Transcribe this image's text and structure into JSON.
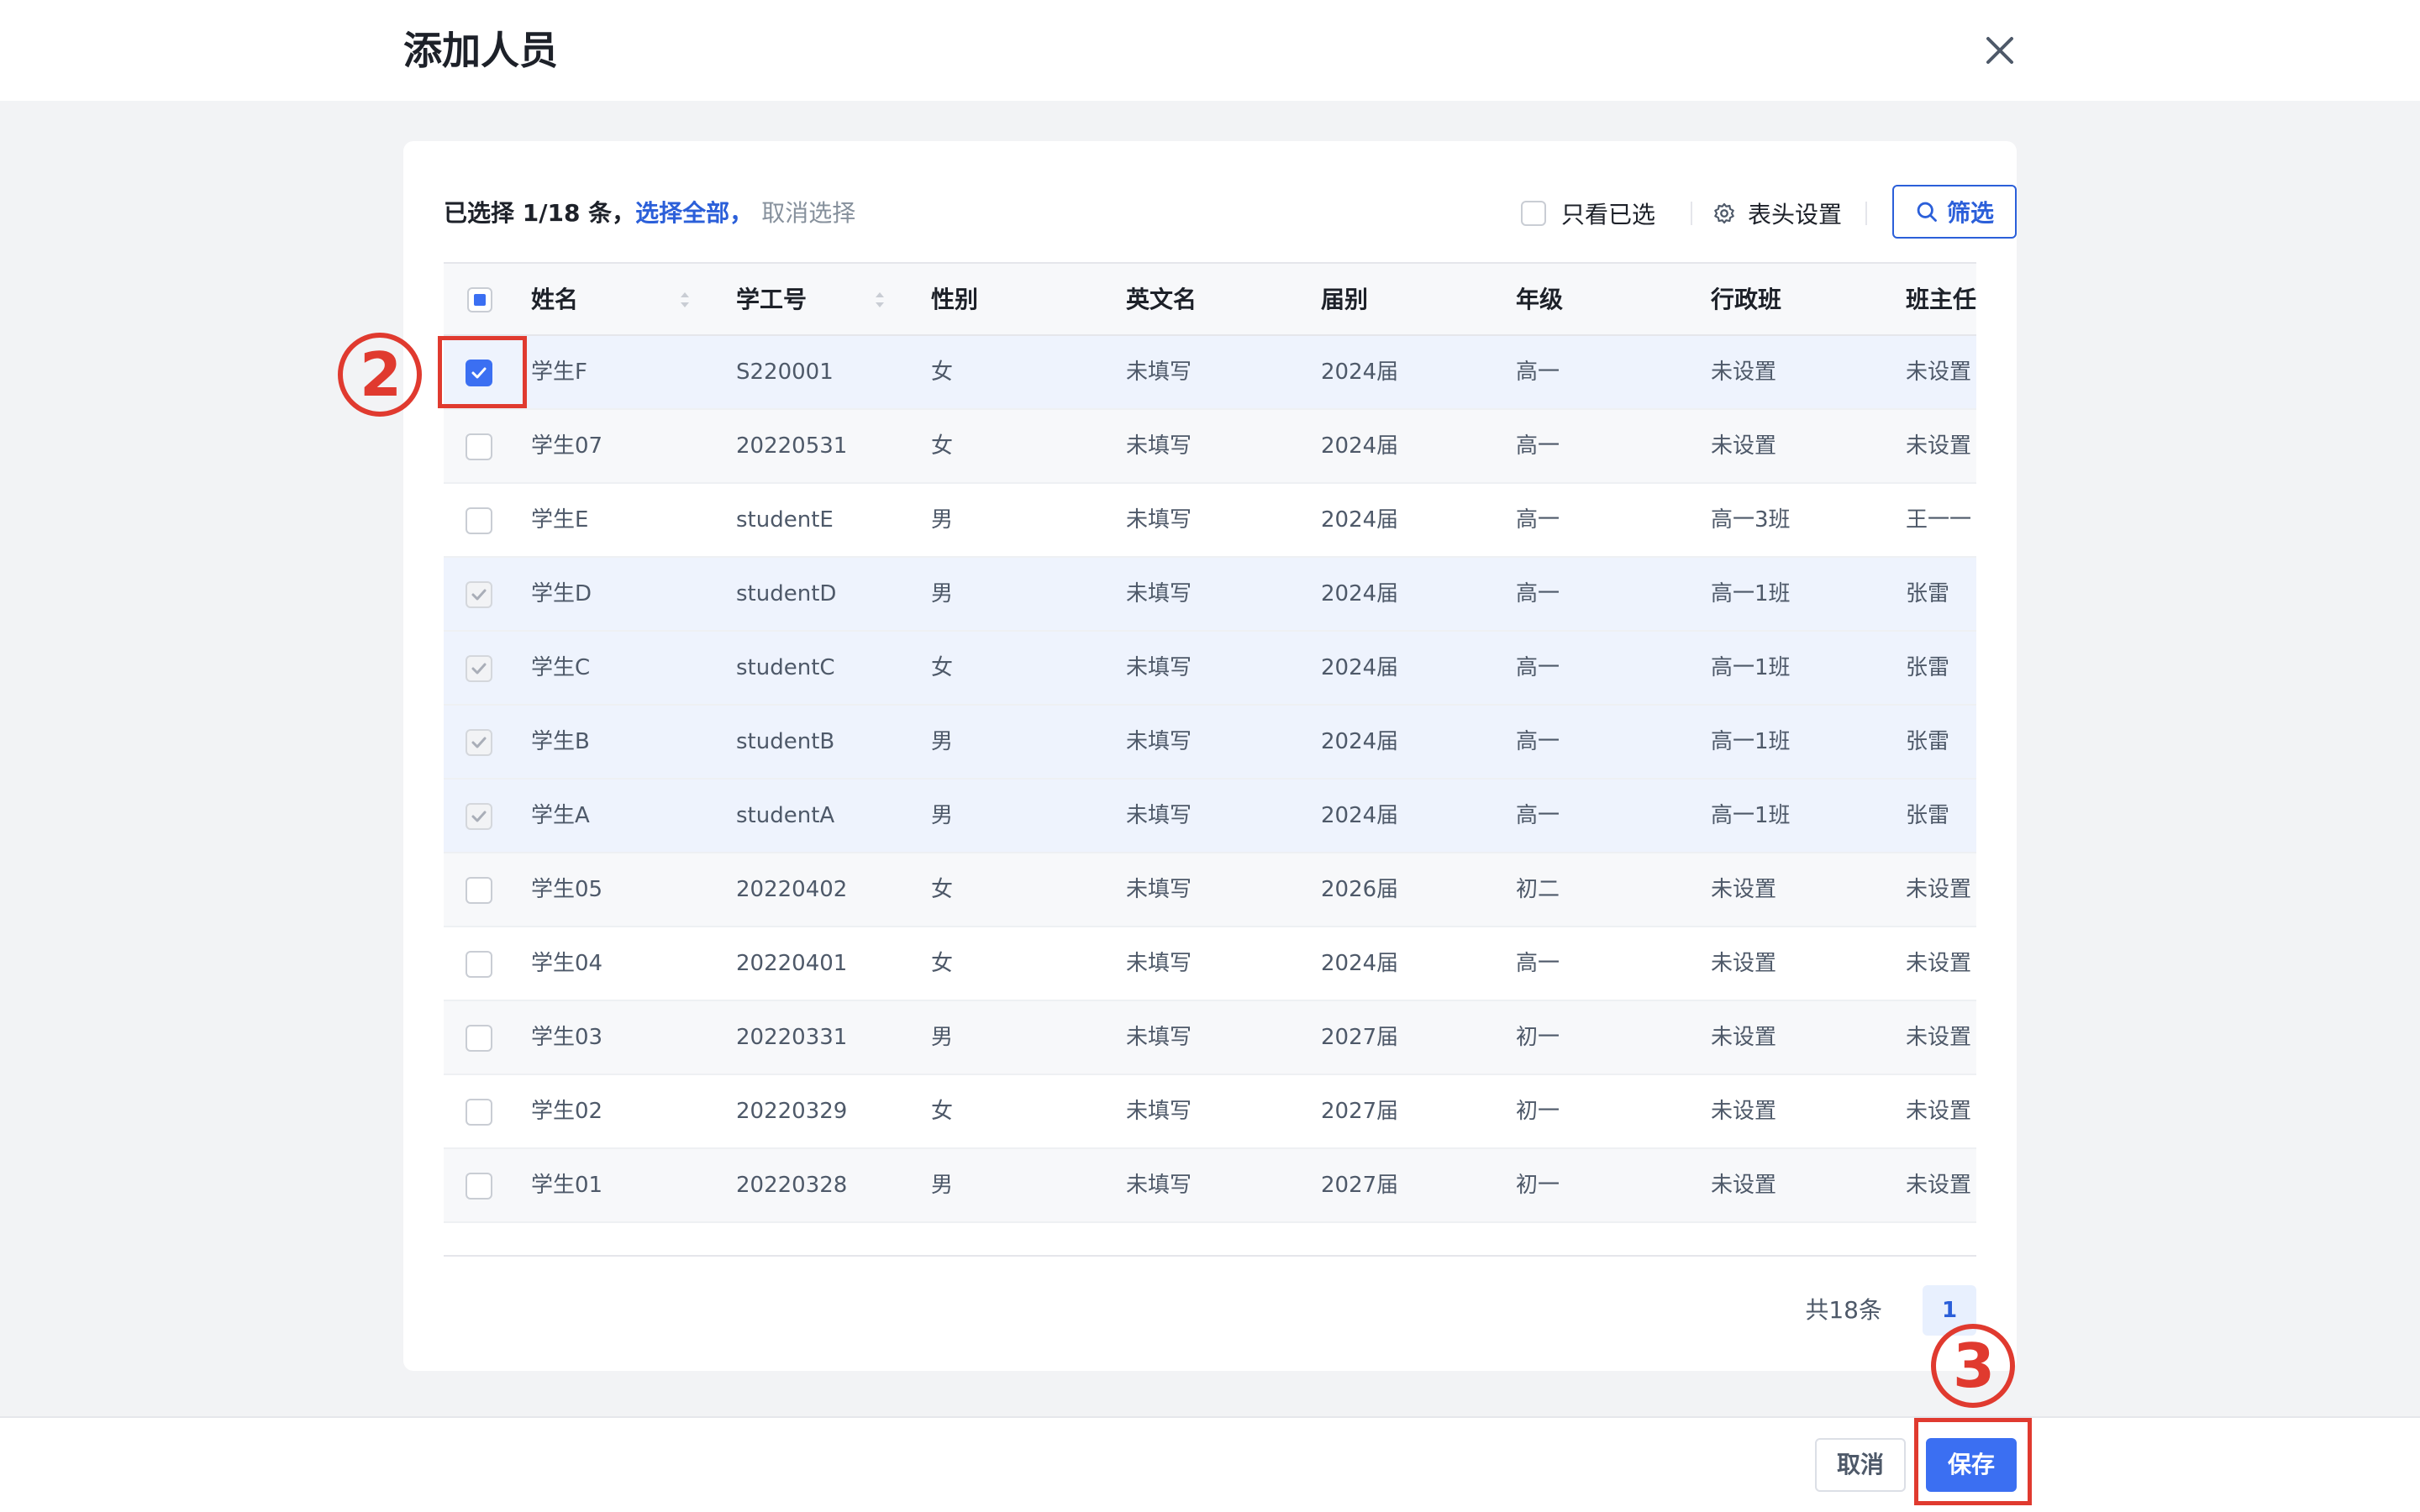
{
  "dialog": {
    "title": "添加人员",
    "close_icon": "close-icon"
  },
  "toolbar": {
    "selected_count": "已选择 1/18 条，",
    "select_all": "选择全部，",
    "cancel_selection": "取消选择",
    "only_selected_label": "只看已选",
    "column_settings_label": "表头设置",
    "column_settings_icon": "gear-icon",
    "filter_label": "筛选",
    "filter_icon": "search-icon"
  },
  "table": {
    "headers": {
      "name": "姓名",
      "id": "学工号",
      "gender": "性别",
      "english_name": "英文名",
      "cohort": "届别",
      "grade": "年级",
      "admin_class": "行政班",
      "head_teacher": "班主任"
    },
    "rows": [
      {
        "name": "学生F",
        "id": "S220001",
        "gender": "女",
        "english_name": "未填写",
        "cohort": "2024届",
        "grade": "高一",
        "admin_class": "未设置",
        "head_teacher": "未设置",
        "state": "checked"
      },
      {
        "name": "学生07",
        "id": "20220531",
        "gender": "女",
        "english_name": "未填写",
        "cohort": "2024届",
        "grade": "高一",
        "admin_class": "未设置",
        "head_teacher": "未设置",
        "state": "unchecked"
      },
      {
        "name": "学生E",
        "id": "studentE",
        "gender": "男",
        "english_name": "未填写",
        "cohort": "2024届",
        "grade": "高一",
        "admin_class": "高一3班",
        "head_teacher": "王一一",
        "state": "unchecked"
      },
      {
        "name": "学生D",
        "id": "studentD",
        "gender": "男",
        "english_name": "未填写",
        "cohort": "2024届",
        "grade": "高一",
        "admin_class": "高一1班",
        "head_teacher": "张雷",
        "state": "disabled"
      },
      {
        "name": "学生C",
        "id": "studentC",
        "gender": "女",
        "english_name": "未填写",
        "cohort": "2024届",
        "grade": "高一",
        "admin_class": "高一1班",
        "head_teacher": "张雷",
        "state": "disabled"
      },
      {
        "name": "学生B",
        "id": "studentB",
        "gender": "男",
        "english_name": "未填写",
        "cohort": "2024届",
        "grade": "高一",
        "admin_class": "高一1班",
        "head_teacher": "张雷",
        "state": "disabled"
      },
      {
        "name": "学生A",
        "id": "studentA",
        "gender": "男",
        "english_name": "未填写",
        "cohort": "2024届",
        "grade": "高一",
        "admin_class": "高一1班",
        "head_teacher": "张雷",
        "state": "disabled"
      },
      {
        "name": "学生05",
        "id": "20220402",
        "gender": "女",
        "english_name": "未填写",
        "cohort": "2026届",
        "grade": "初二",
        "admin_class": "未设置",
        "head_teacher": "未设置",
        "state": "unchecked"
      },
      {
        "name": "学生04",
        "id": "20220401",
        "gender": "女",
        "english_name": "未填写",
        "cohort": "2024届",
        "grade": "高一",
        "admin_class": "未设置",
        "head_teacher": "未设置",
        "state": "unchecked"
      },
      {
        "name": "学生03",
        "id": "20220331",
        "gender": "男",
        "english_name": "未填写",
        "cohort": "2027届",
        "grade": "初一",
        "admin_class": "未设置",
        "head_teacher": "未设置",
        "state": "unchecked"
      },
      {
        "name": "学生02",
        "id": "20220329",
        "gender": "女",
        "english_name": "未填写",
        "cohort": "2027届",
        "grade": "初一",
        "admin_class": "未设置",
        "head_teacher": "未设置",
        "state": "unchecked"
      },
      {
        "name": "学生01",
        "id": "20220328",
        "gender": "男",
        "english_name": "未填写",
        "cohort": "2027届",
        "grade": "初一",
        "admin_class": "未设置",
        "head_teacher": "未设置",
        "state": "unchecked"
      }
    ]
  },
  "pagination": {
    "total": "共18条",
    "current_page": "1"
  },
  "footer": {
    "cancel_label": "取消",
    "save_label": "保存"
  },
  "annotations": {
    "step_2": "2",
    "step_3": "3",
    "color": "#e03a2f"
  },
  "colors": {
    "accent": "#3b6ff2",
    "link": "#2b5fd9",
    "highlight_row": "#eef3fd"
  }
}
